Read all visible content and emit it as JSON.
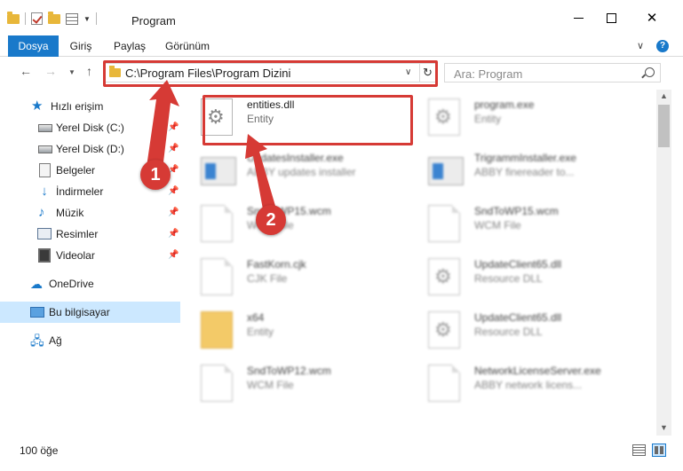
{
  "window": {
    "title": "Program",
    "controls": {
      "minimize": "minimize",
      "maximize": "maximize",
      "close": "✕"
    }
  },
  "ribbon": {
    "tabs": [
      {
        "label": "Dosya",
        "active": true
      },
      {
        "label": "Giriş"
      },
      {
        "label": "Paylaş"
      },
      {
        "label": "Görünüm"
      }
    ],
    "help_label": "?"
  },
  "address_bar": {
    "path": "C:\\Program Files\\Program Dizini"
  },
  "search": {
    "placeholder": "Ara: Program"
  },
  "navigation": {
    "items": [
      {
        "label": "Hızlı erişim",
        "icon": "star-icon"
      },
      {
        "label": "Yerel Disk (C:)",
        "icon": "drive-icon",
        "pinned": true
      },
      {
        "label": "Yerel Disk (D:)",
        "icon": "drive-icon",
        "pinned": true
      },
      {
        "label": "Belgeler",
        "icon": "documents-icon",
        "pinned": true
      },
      {
        "label": "İndirmeler",
        "icon": "downloads-icon",
        "pinned": true
      },
      {
        "label": "Müzik",
        "icon": "music-icon",
        "pinned": true
      },
      {
        "label": "Resimler",
        "icon": "pictures-icon",
        "pinned": true
      },
      {
        "label": "Videolar",
        "icon": "videos-icon",
        "pinned": true
      },
      {
        "label": "OneDrive",
        "icon": "cloud-icon"
      },
      {
        "label": "Bu bilgisayar",
        "icon": "computer-icon",
        "selected": true
      },
      {
        "label": "Ağ",
        "icon": "network-icon"
      }
    ]
  },
  "files": [
    {
      "name": "entities.dll",
      "type": "Entity",
      "icon": "gear-file-icon",
      "highlighted": true
    },
    {
      "name": "program.exe",
      "type": "Entity",
      "icon": "exe-icon"
    },
    {
      "name": "UpdatesInstaller.exe",
      "type": "ABBY updates installer",
      "icon": "exe-icon"
    },
    {
      "name": "TrigrammInstaller.exe",
      "type": "ABBY finereader to...",
      "icon": "exe-icon"
    },
    {
      "name": "SndToWP15.wcm",
      "type": "WCM File",
      "icon": "page-icon"
    },
    {
      "name": "SndToWP15.wcm",
      "type": "WCM File",
      "icon": "page-icon"
    },
    {
      "name": "FastKorn.cjk",
      "type": "CJK File",
      "icon": "page-icon"
    },
    {
      "name": "UpdateClient65.dll",
      "type": "Resource DLL",
      "icon": "gear-file-icon"
    },
    {
      "name": "x64",
      "type": "Entity",
      "icon": "folder-icon"
    },
    {
      "name": "UpdateClient65.dll",
      "type": "Resource DLL",
      "icon": "gear-file-icon"
    },
    {
      "name": "SndToWP12.wcm",
      "type": "WCM File",
      "icon": "page-icon"
    },
    {
      "name": "NetworkLicenseServer.exe",
      "type": "ABBY network licens...",
      "icon": "page-icon"
    }
  ],
  "status": {
    "item_count": "100 öğe"
  },
  "callouts": [
    "1",
    "2"
  ],
  "colors": {
    "accent": "#1979ca",
    "highlight_red": "#d63a35",
    "selection": "#cce8ff"
  }
}
